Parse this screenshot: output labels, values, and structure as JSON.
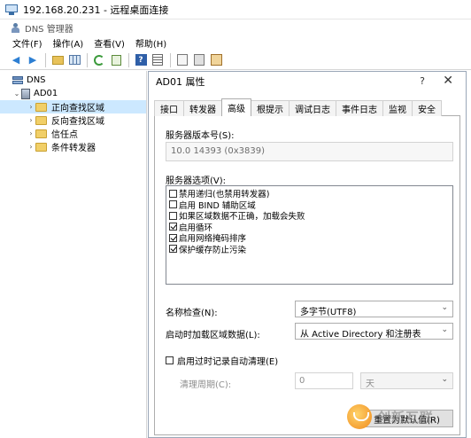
{
  "rdp": {
    "title": "192.168.20.231 - 远程桌面连接"
  },
  "app": {
    "title": "DNS 管理器"
  },
  "menu": {
    "items": [
      "文件(F)",
      "操作(A)",
      "查看(V)",
      "帮助(H)"
    ]
  },
  "toolbar": {
    "icons": [
      "back-arrow-icon",
      "forward-arrow-icon",
      "up-folder-icon",
      "show-hide-tree-icon",
      "refresh-icon",
      "export-list-icon",
      "help-icon",
      "properties-icon",
      "document-icon",
      "document-2-icon",
      "server-icon"
    ]
  },
  "tree": {
    "root": "DNS",
    "server": "AD01",
    "children": [
      "正向查找区域",
      "反向查找区域",
      "信任点",
      "条件转发器"
    ],
    "selected_index": 0
  },
  "dialog": {
    "title": "AD01 属性",
    "help_glyph": "?",
    "close_glyph": "✕",
    "tabs": [
      "接口",
      "转发器",
      "高级",
      "根提示",
      "调试日志",
      "事件日志",
      "监视",
      "安全"
    ],
    "active_tab_index": 2,
    "version_label": "服务器版本号(S):",
    "version_value": "10.0 14393 (0x3839)",
    "options_label": "服务器选项(V):",
    "options": [
      {
        "label": "禁用递归(也禁用转发器)",
        "checked": false
      },
      {
        "label": "启用 BIND 辅助区域",
        "checked": false
      },
      {
        "label": "如果区域数据不正确，加载会失败",
        "checked": false
      },
      {
        "label": "启用循环",
        "checked": true
      },
      {
        "label": "启用网络掩码排序",
        "checked": true
      },
      {
        "label": "保护缓存防止污染",
        "checked": true
      }
    ],
    "name_check_label": "名称检查(N):",
    "name_check_value": "多字节(UTF8)",
    "load_zone_label": "启动时加载区域数据(L):",
    "load_zone_value": "从 Active Directory 和注册表",
    "scavenge_label": "启用过时记录自动清理(E)",
    "scavenge_checked": false,
    "period_label": "清理周期(C):",
    "period_value": "0",
    "period_unit": "天",
    "reset_button": "重置为默认值(R)"
  },
  "watermark": {
    "text": "创新互联"
  }
}
